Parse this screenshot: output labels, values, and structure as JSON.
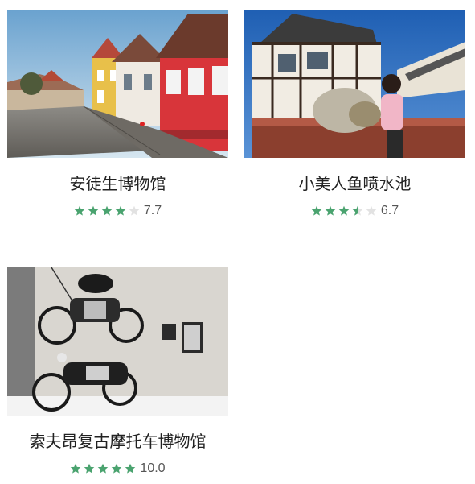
{
  "colors": {
    "star_filled": "#4aa36f",
    "star_empty": "#e2e2e2",
    "title_text": "#222222",
    "score_text": "#555555"
  },
  "attractions": [
    {
      "name": "安徒生博物馆",
      "score": "7.7",
      "stars": 4,
      "photo": "street-colorful-houses-photo"
    },
    {
      "name": "小美人鱼喷水池",
      "score": "6.7",
      "stars": 3.5,
      "photo": "woman-at-fountain-photo"
    },
    {
      "name": "索夫昂复古摩托车博物馆",
      "score": "10.0",
      "stars": 5,
      "photo": "vintage-motorcycles-photo"
    }
  ]
}
